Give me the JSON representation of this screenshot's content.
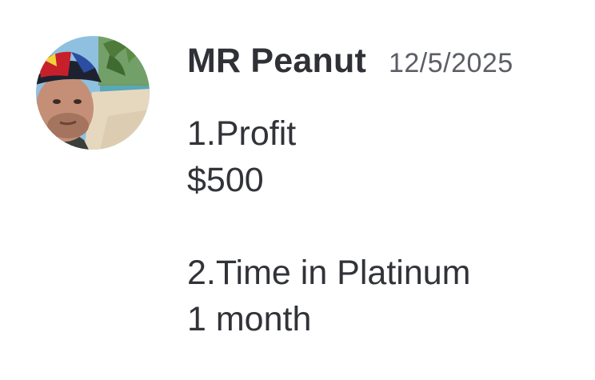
{
  "message": {
    "author": {
      "name": "MR Peanut",
      "avatar": "user-avatar-photo"
    },
    "timestamp": "12/5/2025",
    "content_lines": [
      "1.Profit",
      "$500",
      "",
      "2.Time in Platinum",
      "1 month"
    ]
  },
  "colors": {
    "background": "#ffffff",
    "username": "#2f3136",
    "timestamp": "#5c5e66",
    "text": "#313338"
  }
}
